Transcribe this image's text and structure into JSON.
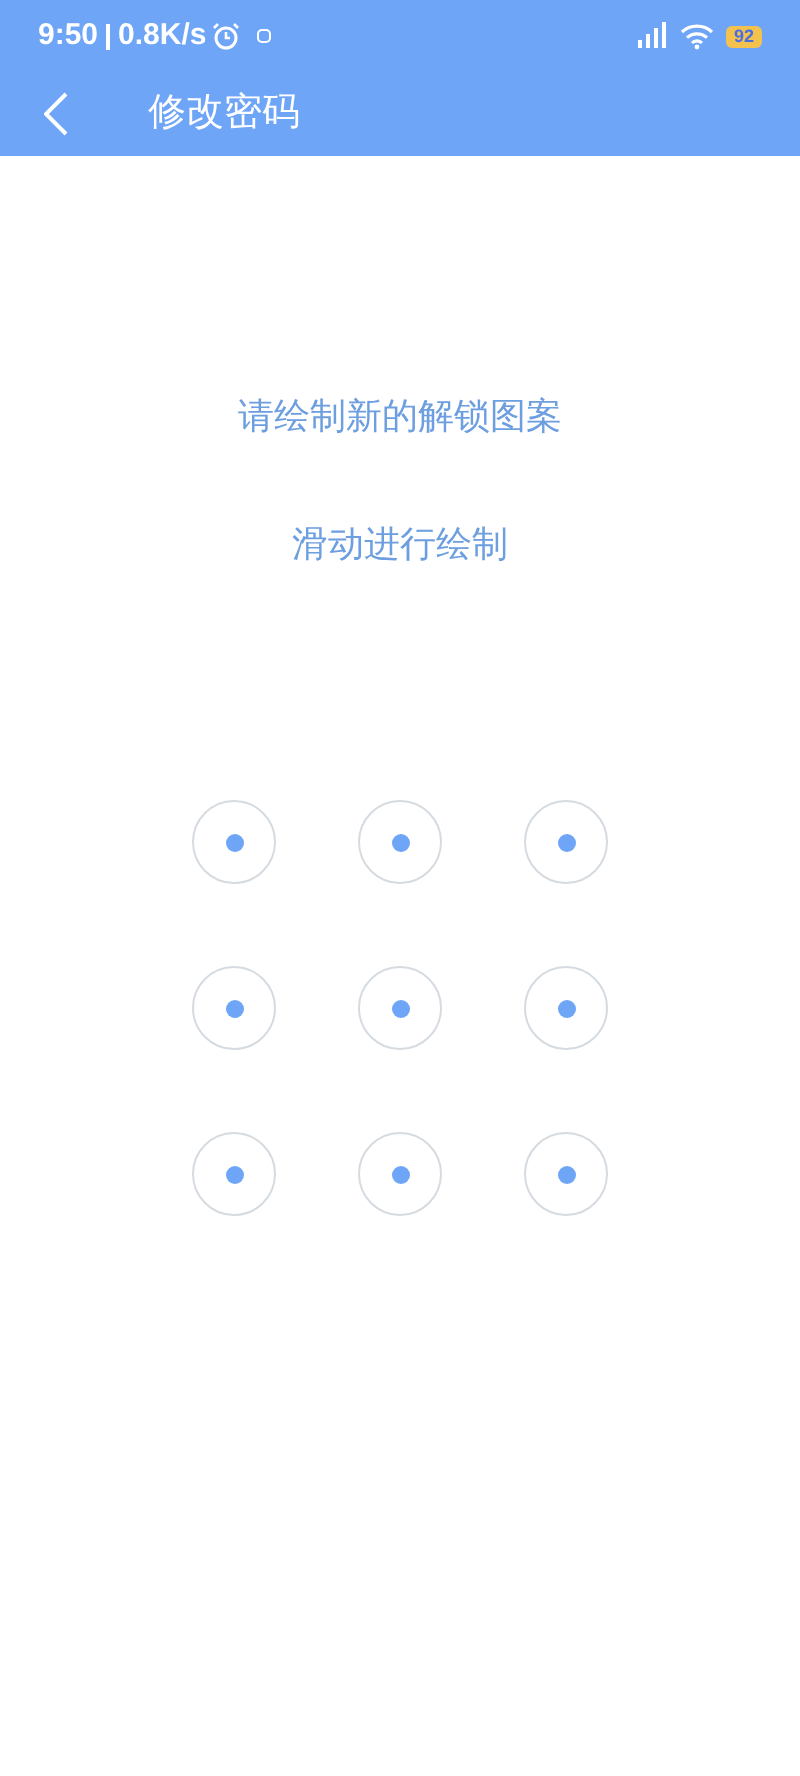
{
  "status_bar": {
    "time": "9:50",
    "speed": "0.8K/s",
    "battery": "92"
  },
  "header": {
    "title": "修改密码"
  },
  "prompt": {
    "title": "请绘制新的解锁图案",
    "hint": "滑动进行绘制"
  },
  "pattern": {
    "points": [
      {
        "selected": false
      },
      {
        "selected": false
      },
      {
        "selected": false
      },
      {
        "selected": false
      },
      {
        "selected": false
      },
      {
        "selected": false
      },
      {
        "selected": false
      },
      {
        "selected": false
      },
      {
        "selected": false
      }
    ]
  }
}
